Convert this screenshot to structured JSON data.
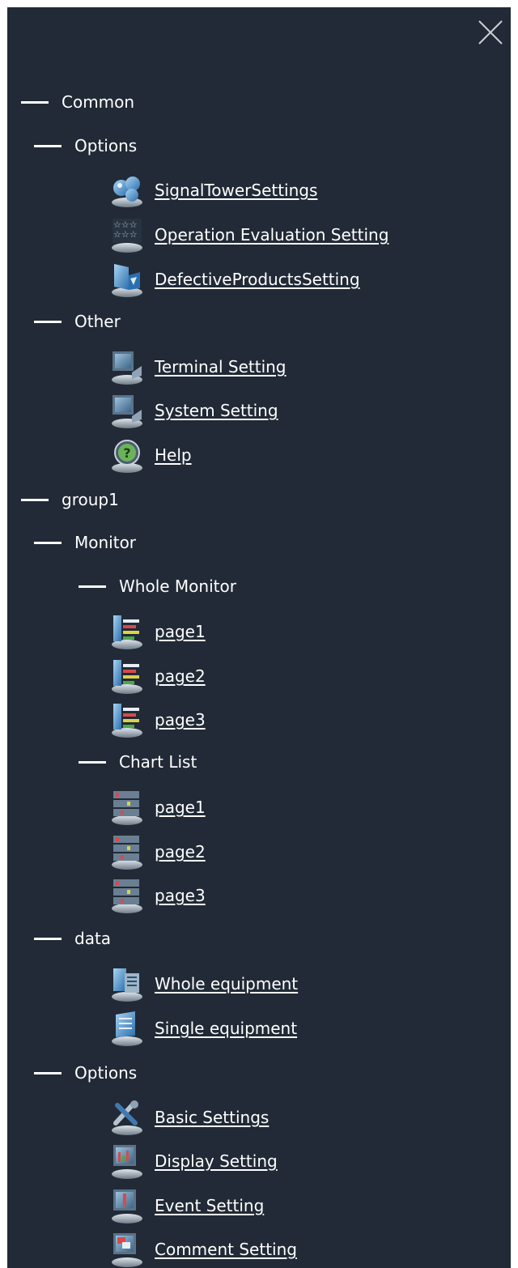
{
  "close_icon": "close-icon",
  "common": {
    "label": "Common",
    "options": {
      "label": "Options",
      "items": [
        {
          "label": "SignalTowerSettings",
          "icon": "signal-tower-icon"
        },
        {
          "label": "Operation Evaluation Setting",
          "icon": "star-rating-icon"
        },
        {
          "label": "DefectiveProductsSetting",
          "icon": "defective-product-icon"
        }
      ]
    },
    "other": {
      "label": "Other",
      "items": [
        {
          "label": "Terminal Setting",
          "icon": "monitor-icon"
        },
        {
          "label": "System Setting",
          "icon": "monitor-icon"
        },
        {
          "label": "Help",
          "icon": "help-icon"
        }
      ]
    }
  },
  "group1": {
    "label": "group1",
    "monitor": {
      "label": "Monitor",
      "whole_monitor": {
        "label": "Whole Monitor",
        "items": [
          {
            "label": "page1",
            "icon": "whole-monitor-icon"
          },
          {
            "label": "page2",
            "icon": "whole-monitor-icon"
          },
          {
            "label": "page3",
            "icon": "whole-monitor-icon"
          }
        ]
      },
      "chart_list": {
        "label": "Chart List",
        "items": [
          {
            "label": "page1",
            "icon": "chart-list-icon"
          },
          {
            "label": "page2",
            "icon": "chart-list-icon"
          },
          {
            "label": "page3",
            "icon": "chart-list-icon"
          }
        ]
      }
    },
    "data": {
      "label": "data",
      "items": [
        {
          "label": "Whole equipment",
          "icon": "whole-equipment-icon"
        },
        {
          "label": "Single equipment",
          "icon": "single-equipment-icon"
        }
      ]
    },
    "options": {
      "label": "Options",
      "items": [
        {
          "label": "Basic Settings",
          "icon": "tools-icon"
        },
        {
          "label": "Display Setting",
          "icon": "display-setting-icon"
        },
        {
          "label": "Event Setting",
          "icon": "event-setting-icon"
        },
        {
          "label": "Comment Setting",
          "icon": "comment-setting-icon"
        }
      ]
    }
  }
}
